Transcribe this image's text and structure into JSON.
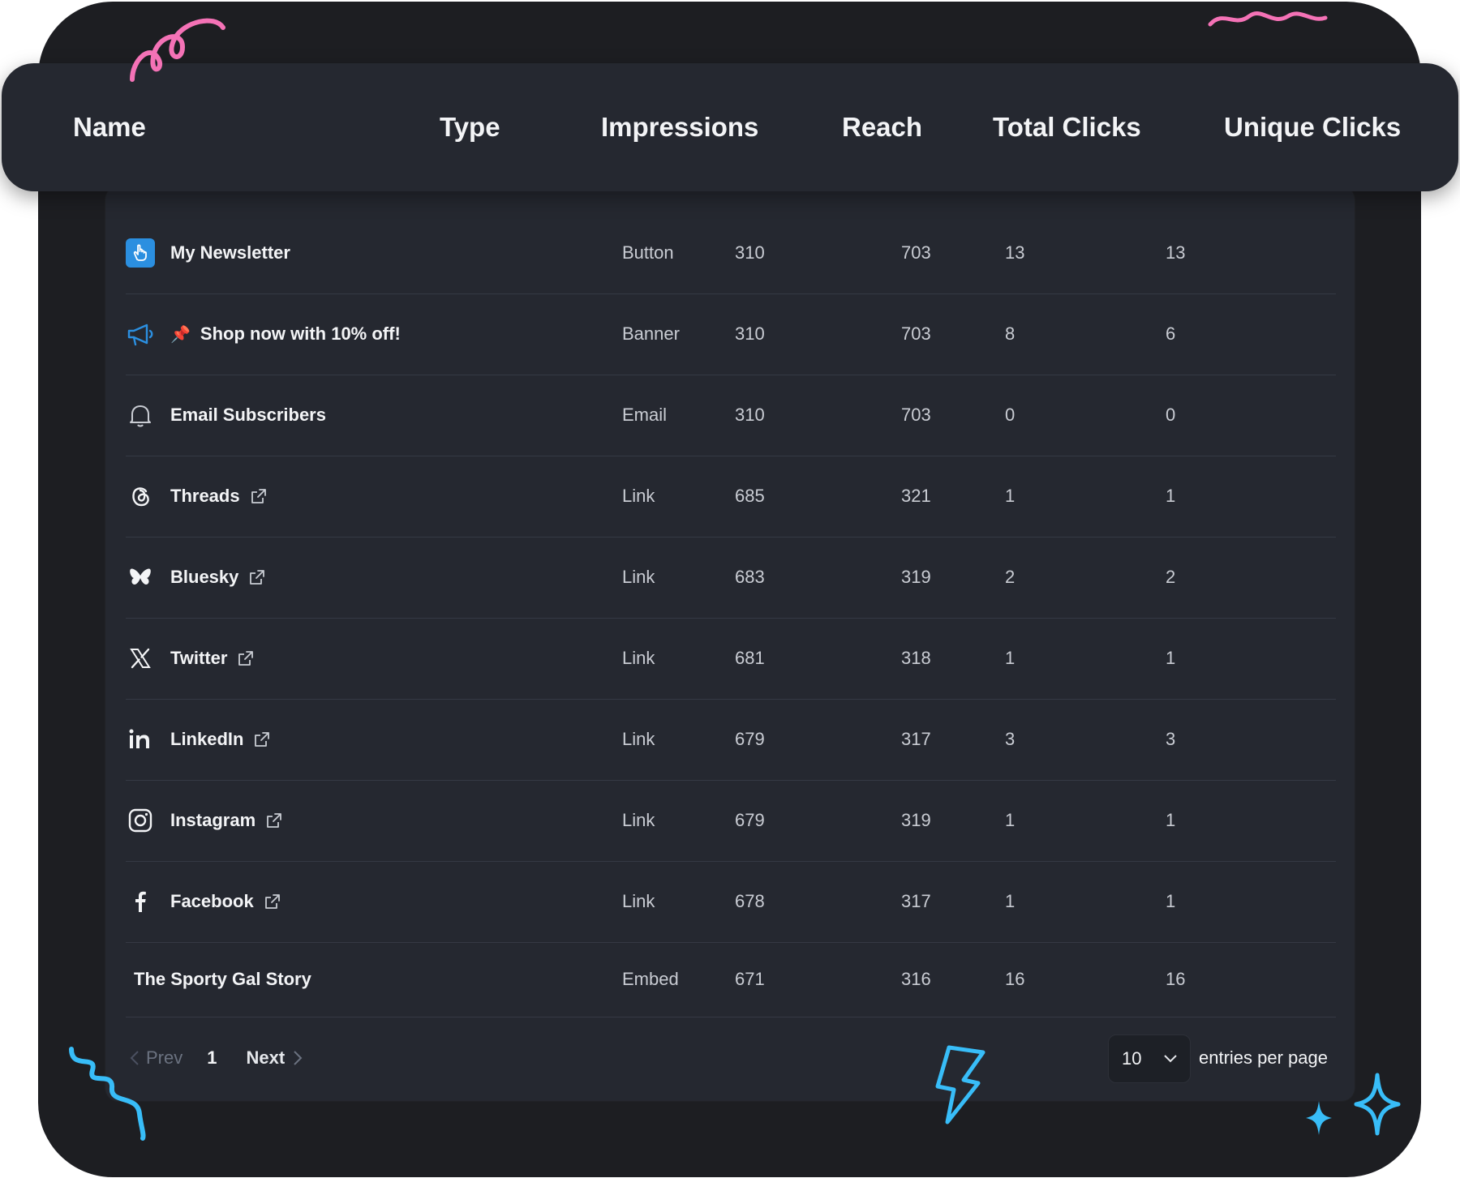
{
  "columns": [
    "Name",
    "Type",
    "Impressions",
    "Reach",
    "Total Clicks",
    "Unique Clicks"
  ],
  "rows": [
    {
      "name": "My Newsletter",
      "icon": "pointer-hand-icon",
      "prefix": "",
      "external": false,
      "type": "Button",
      "impressions": "310",
      "reach": "703",
      "total_clicks": "13",
      "unique_clicks": "13"
    },
    {
      "name": "Shop now with 10% off!",
      "icon": "megaphone-icon",
      "prefix": "📌",
      "external": false,
      "type": "Banner",
      "impressions": "310",
      "reach": "703",
      "total_clicks": "8",
      "unique_clicks": "6"
    },
    {
      "name": "Email Subscribers",
      "icon": "bell-icon",
      "prefix": "",
      "external": false,
      "type": "Email",
      "impressions": "310",
      "reach": "703",
      "total_clicks": "0",
      "unique_clicks": "0"
    },
    {
      "name": "Threads",
      "icon": "threads-icon",
      "prefix": "",
      "external": true,
      "type": "Link",
      "impressions": "685",
      "reach": "321",
      "total_clicks": "1",
      "unique_clicks": "1"
    },
    {
      "name": "Bluesky",
      "icon": "bluesky-icon",
      "prefix": "",
      "external": true,
      "type": "Link",
      "impressions": "683",
      "reach": "319",
      "total_clicks": "2",
      "unique_clicks": "2"
    },
    {
      "name": "Twitter",
      "icon": "x-twitter-icon",
      "prefix": "",
      "external": true,
      "type": "Link",
      "impressions": "681",
      "reach": "318",
      "total_clicks": "1",
      "unique_clicks": "1"
    },
    {
      "name": "LinkedIn",
      "icon": "linkedin-icon",
      "prefix": "",
      "external": true,
      "type": "Link",
      "impressions": "679",
      "reach": "317",
      "total_clicks": "3",
      "unique_clicks": "3"
    },
    {
      "name": "Instagram",
      "icon": "instagram-icon",
      "prefix": "",
      "external": true,
      "type": "Link",
      "impressions": "679",
      "reach": "319",
      "total_clicks": "1",
      "unique_clicks": "1"
    },
    {
      "name": "Facebook",
      "icon": "facebook-icon",
      "prefix": "",
      "external": true,
      "type": "Link",
      "impressions": "678",
      "reach": "317",
      "total_clicks": "1",
      "unique_clicks": "1"
    },
    {
      "name": "The Sporty Gal Story",
      "icon": "",
      "prefix": "",
      "external": false,
      "type": "Embed",
      "impressions": "671",
      "reach": "316",
      "total_clicks": "16",
      "unique_clicks": "16"
    }
  ],
  "pagination": {
    "prev_label": "Prev",
    "current_page": "1",
    "next_label": "Next",
    "per_page_value": "10",
    "per_page_label": "entries per page"
  },
  "colors": {
    "outer_background": "#1d1e22",
    "panel_background": "#252830",
    "accent_blue": "#2b8fe0",
    "decor_pink": "#f472b6",
    "decor_cyan": "#38bdf8"
  }
}
